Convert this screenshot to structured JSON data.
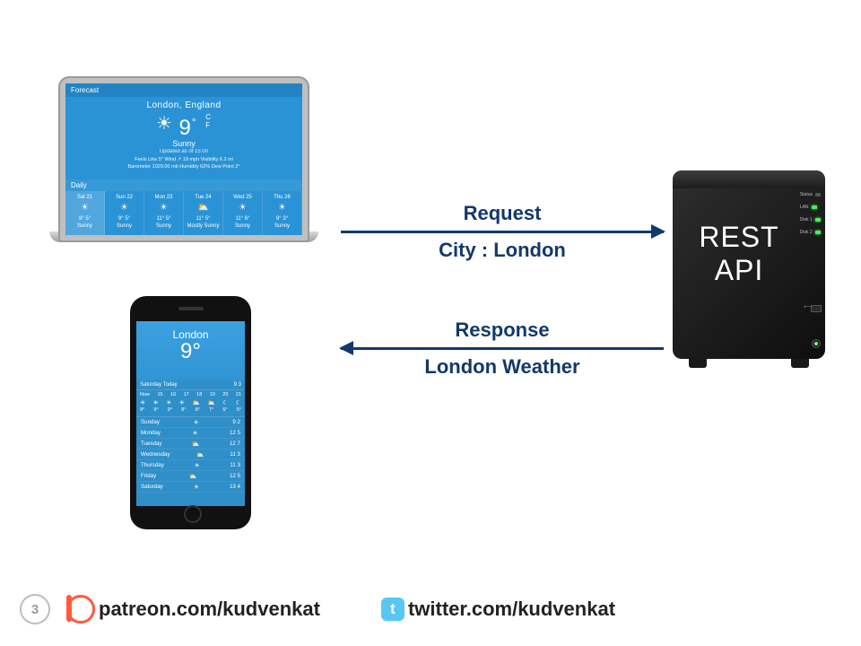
{
  "laptop": {
    "header": "Forecast",
    "city": "London, England",
    "temp_value": "9",
    "temp_unit_top": "C",
    "temp_unit_bottom": "F",
    "condition": "Sunny",
    "updated": "Updated as of 15:00",
    "stats_line1": "Feels Like  5°        Wind ↗ 19 mph     Visibility  6.2 mi",
    "stats_line2": "Barometer 1020.00 mb    Humidity 62%     Dew Point 2°",
    "daily_label": "Daily",
    "days": [
      {
        "dow": "Sat 21",
        "icon": "☀",
        "hi": "9°",
        "lo": "5°",
        "cond": "Sunny"
      },
      {
        "dow": "Sun 22",
        "icon": "☀",
        "hi": "9°",
        "lo": "5°",
        "cond": "Sunny"
      },
      {
        "dow": "Mon 23",
        "icon": "☀",
        "hi": "11°",
        "lo": "5°",
        "cond": "Sunny"
      },
      {
        "dow": "Tue 24",
        "icon": "⛅",
        "hi": "11°",
        "lo": "5°",
        "cond": "Mostly Sunny"
      },
      {
        "dow": "Wed 25",
        "icon": "☀",
        "hi": "11°",
        "lo": "6°",
        "cond": "Sunny"
      },
      {
        "dow": "Thu 26",
        "icon": "☀",
        "hi": "9°",
        "lo": "3°",
        "cond": "Sunny"
      }
    ]
  },
  "phone": {
    "city": "London",
    "temp": "9°",
    "sub_left": "Saturday  Today",
    "sub_right": "9   3",
    "hours_labels": [
      "Now",
      "15",
      "16",
      "17",
      "18",
      "19",
      "20",
      "21"
    ],
    "hours_icons": [
      "☀",
      "☀",
      "☀",
      "☀",
      "⛅",
      "⛅",
      "☾",
      "☾"
    ],
    "hours_temps": [
      "9°",
      "9°",
      "9°",
      "8°",
      "8°",
      "7°",
      "5°",
      "5°"
    ],
    "list": [
      {
        "day": "Sunday",
        "icon": "☀",
        "hi": "9",
        "lo": "2"
      },
      {
        "day": "Monday",
        "icon": "☀",
        "hi": "12",
        "lo": "5"
      },
      {
        "day": "Tuesday",
        "icon": "⛅",
        "hi": "12",
        "lo": "7"
      },
      {
        "day": "Wednesday",
        "icon": "⛅",
        "hi": "11",
        "lo": "3"
      },
      {
        "day": "Thursday",
        "icon": "☀",
        "hi": "11",
        "lo": "3"
      },
      {
        "day": "Friday",
        "icon": "⛅",
        "hi": "12",
        "lo": "5"
      },
      {
        "day": "Saturday",
        "icon": "☀",
        "hi": "13",
        "lo": "4"
      }
    ]
  },
  "server": {
    "label_line1": "REST",
    "label_line2": "API",
    "leds": [
      "Status",
      "LAN",
      "Disk 1",
      "Disk 2"
    ]
  },
  "arrows": {
    "request_label": "Request",
    "request_sub": "City : London",
    "response_label": "Response",
    "response_sub": "London Weather"
  },
  "footer": {
    "page_number": "3",
    "patreon": "patreon.com/kudvenkat",
    "twitter": "twitter.com/kudvenkat"
  }
}
